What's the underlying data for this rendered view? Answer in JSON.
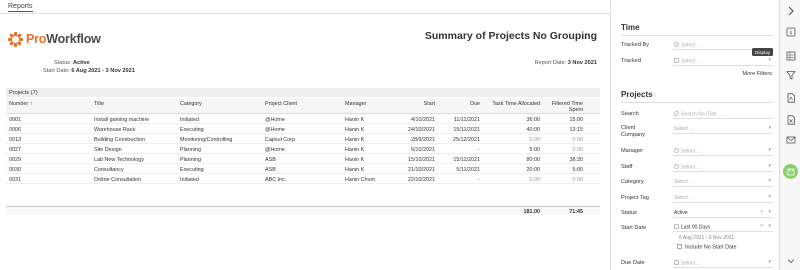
{
  "breadcrumb": "Reports",
  "logo": {
    "brand_a": "Pro",
    "brand_b": "Workflow"
  },
  "report": {
    "title": "Summary of Projects No Grouping",
    "status_label": "Status:",
    "status_value": "Active",
    "start_label": "Start Date:",
    "start_value": "6 Aug 2021 - 3 Nov 2021",
    "report_date_label": "Report Date:",
    "report_date_value": "3 Nov 2021",
    "projects_band": "Projects  (7)"
  },
  "table": {
    "headers": [
      "Number",
      "Title",
      "Category",
      "Project Client",
      "Manager",
      "Start",
      "Due",
      "Task Time Allocated",
      "Filtered Time Spent"
    ],
    "sort_icon": "↑",
    "rows": [
      [
        "0001",
        "Install gaming machine",
        "Initiated",
        "@Home",
        "Hanin K",
        "4/10/2021",
        "11/11/2021",
        "36:00",
        "15:00"
      ],
      [
        "0006",
        "Warehouse Rack",
        "Executing",
        "@Home",
        "Hanin K",
        "24/10/2021",
        "15/11/2021",
        "40:00",
        "13:15"
      ],
      [
        "0013",
        "Building Construction",
        "Monitoring/Controlling",
        "Capsul Corp",
        "Hanin K",
        "28/9/2021",
        "25/12/2021",
        "0.00",
        "0.00"
      ],
      [
        "0027",
        "Site Design",
        "Planning",
        "@Home",
        "Hanin K",
        "6/10/2021",
        "–",
        "5:00",
        "0.00"
      ],
      [
        "0029",
        "Lab New Technology",
        "Planning",
        "ASB",
        "Hanin K",
        "15/10/2021",
        "15/11/2021",
        "80:00",
        "38:30"
      ],
      [
        "0030",
        "Consultancy",
        "Executing",
        "ASB",
        "Hanin K",
        "21/10/2021",
        "5/11/2021",
        "20:00",
        "5:00"
      ],
      [
        "0031",
        "Online Consultation",
        "Initiated",
        "ABC Inc.",
        "Hanin Chum",
        "22/10/2021",
        "–",
        "0.00",
        "0.00"
      ]
    ],
    "total_allocated": "181.00",
    "total_spent": "71:45"
  },
  "filters": {
    "time_title": "Time",
    "tracked_by_label": "Tracked By",
    "tracked_by_value": "Select ...",
    "tracked_label": "Tracked",
    "tracked_value": "Select ...",
    "more_filters": "More Filters",
    "projects_title": "Projects",
    "search_label": "Search",
    "search_placeholder": "Search No./Title...",
    "client_label": "Client\nCompany",
    "client_value": "Select ...",
    "manager_label": "Manager",
    "manager_value": "Select ...",
    "staff_label": "Staff",
    "staff_value": "Select ...",
    "category_label": "Category",
    "category_value": "Select ...",
    "tag_label": "Project Tag",
    "tag_value": "Select ...",
    "status_label": "Status",
    "status_value": "Active",
    "start_label": "Start Date",
    "start_value": "Last 90 Days",
    "start_range": "6 Aug 2021 - 3 Nov 2021",
    "include_label": "Include No Start Date",
    "due_label": "Due Date",
    "due_value": "Select ..."
  },
  "toolbar": {
    "tooltip": "Display"
  }
}
